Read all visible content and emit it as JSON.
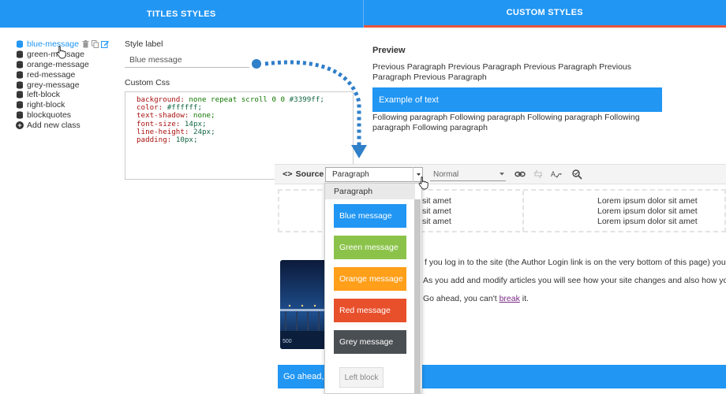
{
  "tabs": [
    {
      "label": "TITLES STYLES"
    },
    {
      "label": "CUSTOM STYLES"
    }
  ],
  "class_list": {
    "items": [
      {
        "label": "blue-message"
      },
      {
        "label": "green-message"
      },
      {
        "label": "orange-message"
      },
      {
        "label": "red-message"
      },
      {
        "label": "grey-message"
      },
      {
        "label": "left-block"
      },
      {
        "label": "right-block"
      },
      {
        "label": "blockquotes"
      }
    ],
    "add_label": "Add new class"
  },
  "form": {
    "style_label_title": "Style label",
    "style_label_value": "Blue message",
    "custom_css_title": "Custom Css",
    "css_lines": [
      {
        "prop": "background:",
        "val": " none repeat scroll 0 0 ",
        "num": "#3399ff;"
      },
      {
        "prop": "color:",
        "val": " ",
        "num": "#ffffff;"
      },
      {
        "prop": "text-shadow:",
        "val": " none;",
        "num": ""
      },
      {
        "prop": "font-size:",
        "val": " ",
        "num": "14px;"
      },
      {
        "prop": "line-height:",
        "val": " ",
        "num": "24px;"
      },
      {
        "prop": "padding:",
        "val": " ",
        "num": "10px;"
      }
    ]
  },
  "preview": {
    "title": "Preview",
    "previous": "Previous Paragraph Previous Paragraph Previous Paragraph Previous Paragraph Previous Paragraph",
    "example": "Example of text",
    "following": "Following paragraph Following paragraph Following paragraph Following paragraph Following paragraph"
  },
  "editor": {
    "source_label": "Source",
    "format_value": "Paragraph",
    "size_value": "Normal",
    "lorem_left": [
      "sit amet",
      "sit amet",
      "sit amet"
    ],
    "lorem_right": [
      "Lorem ipsum dolor sit amet",
      "Lorem ipsum dolor sit amet",
      "Lorem ipsum dolor sit amet"
    ],
    "line1": "f you log in to the site (the Author Login link is on the very bottom of this page) you wi",
    "line2": "As you add and modify articles you will see how your site changes and also how you c",
    "line3_pre": "Go ahead, you can't ",
    "line3_link": "break",
    "line3_post": " it.",
    "bottom_bar": "Go ahead, y",
    "image_caption": "500"
  },
  "dropdown": {
    "paragraph": "Paragraph",
    "items": [
      {
        "label": "Blue message",
        "color": "#2196f3"
      },
      {
        "label": "Green message",
        "color": "#8bc34a"
      },
      {
        "label": "Orange message",
        "color": "#ff9f1a"
      },
      {
        "label": "Red message",
        "color": "#e8502c"
      },
      {
        "label": "Grey message",
        "color": "#4a4f54"
      }
    ],
    "left_block": "Left block"
  },
  "colors": {
    "accent": "#2196f3",
    "active_tab_underline": "#e8553e"
  }
}
